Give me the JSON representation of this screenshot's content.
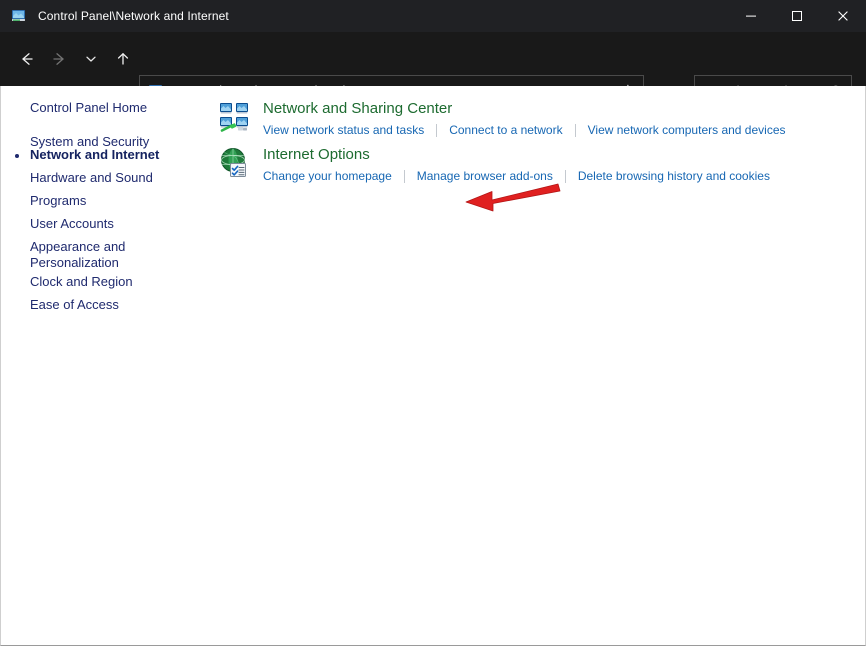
{
  "window": {
    "title": "Control Panel\\Network and Internet",
    "title_icon": "control-panel-network-icon",
    "controls": {
      "minimize": "minimize-icon",
      "maximize": "maximize-icon",
      "close": "close-icon"
    }
  },
  "navbar": {
    "back": "back-arrow-icon",
    "forward": "forward-arrow-icon",
    "recent": "chevron-down-icon",
    "up": "up-arrow-icon",
    "refresh": "refresh-icon",
    "dropdown": "chevron-down-icon",
    "breadcrumb": {
      "icon": "control-panel-network-icon",
      "separator": "›",
      "items": [
        "Control Panel",
        "Network and Internet"
      ]
    }
  },
  "search": {
    "placeholder": "Search Control Panel",
    "value": "",
    "icon": "search-icon"
  },
  "sidebar": {
    "home": "Control Panel Home",
    "items": [
      {
        "label": "System and Security",
        "current": false
      },
      {
        "label": "Network and Internet",
        "current": true
      },
      {
        "label": "Hardware and Sound",
        "current": false
      },
      {
        "label": "Programs",
        "current": false
      },
      {
        "label": "User Accounts",
        "current": false
      },
      {
        "label": "Appearance and Personalization",
        "current": false
      },
      {
        "label": "Clock and Region",
        "current": false
      },
      {
        "label": "Ease of Access",
        "current": false
      }
    ]
  },
  "main": {
    "categories": [
      {
        "title": "Network and Sharing Center",
        "icon": "network-sharing-center-icon",
        "links": [
          "View network status and tasks",
          "Connect to a network",
          "View network computers and devices"
        ]
      },
      {
        "title": "Internet Options",
        "icon": "internet-options-icon",
        "links": [
          "Change your homepage",
          "Manage browser add-ons",
          "Delete browsing history and cookies"
        ]
      }
    ]
  },
  "annotation": {
    "arrow": "red-arrow-pointing-left",
    "color": "#e02020",
    "target": "Network and Sharing Center"
  },
  "colors": {
    "titlebar_bg": "#202124",
    "navbar_bg": "#191919",
    "content_bg": "#ffffff",
    "sidebar_link": "#1f2a6e",
    "category_title": "#1d6b30",
    "task_link": "#1767b3",
    "annotation_red": "#e02020"
  }
}
